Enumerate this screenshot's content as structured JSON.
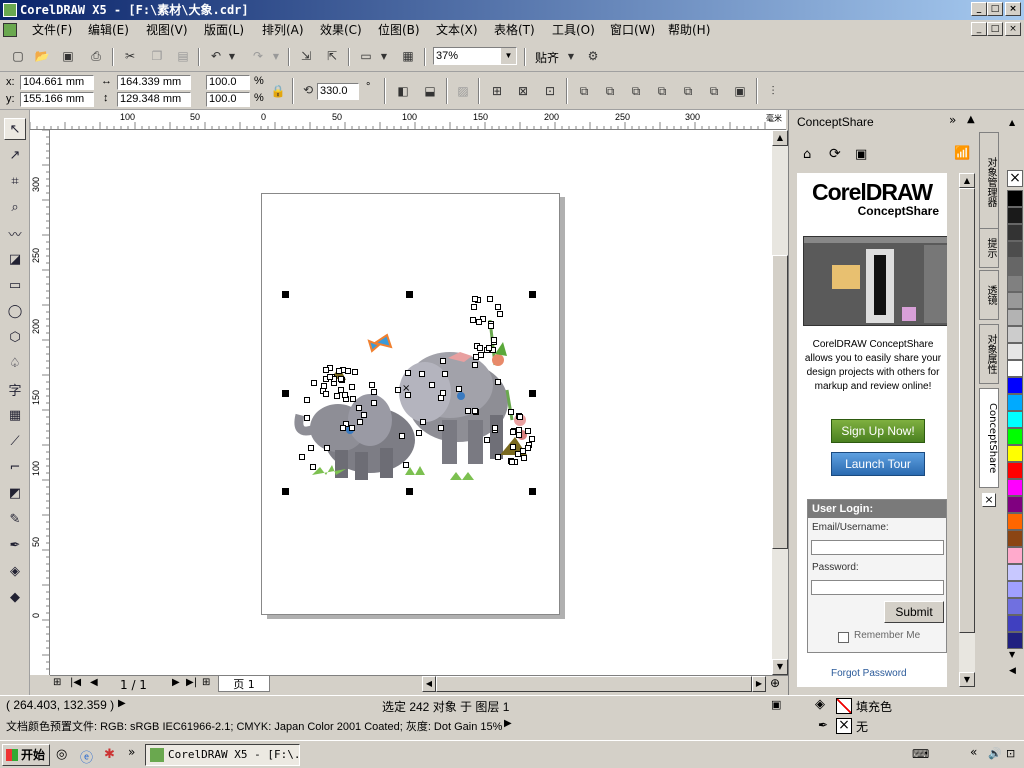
{
  "title_bar": {
    "title": "CorelDRAW X5 - [F:\\素材\\大象.cdr]",
    "min": "_",
    "max": "□",
    "close": "×"
  },
  "doc_controls": {
    "min": "_",
    "restore": "□",
    "close": "×"
  },
  "menu": [
    "文件(F)",
    "编辑(E)",
    "视图(V)",
    "版面(L)",
    "排列(A)",
    "效果(C)",
    "位图(B)",
    "文本(X)",
    "表格(T)",
    "工具(O)",
    "窗口(W)",
    "帮助(H)"
  ],
  "standard_toolbar": {
    "zoom": "37%",
    "snap": "贴齐"
  },
  "property_bar": {
    "x_label": "x:",
    "x": "104.661 mm",
    "y_label": "y:",
    "y": "155.166 mm",
    "w": "164.339 mm",
    "h": "129.348 mm",
    "scale_x": "100.0",
    "scale_y": "100.0",
    "pct": "%",
    "rotation": "330.0",
    "deg": "°"
  },
  "ruler_h_ticks": [
    "100",
    "50",
    "0",
    "50",
    "100",
    "150",
    "200",
    "250",
    "300"
  ],
  "ruler_h_unit": "毫米",
  "ruler_v_ticks": [
    "300",
    "250",
    "200",
    "150",
    "100",
    "50",
    "0"
  ],
  "page_nav": {
    "pages": "1 / 1",
    "tab": "页 1"
  },
  "docker": {
    "title": "ConceptShare",
    "logo_main": "CorelDRAW",
    "logo_sub": "ConceptShare",
    "description": "CorelDRAW ConceptShare allows you to easily share your design projects with others for markup and review online!",
    "sign_up": "Sign Up Now!",
    "tour": "Launch Tour",
    "login_title": "User Login:",
    "email_label": "Email/Username:",
    "password_label": "Password:",
    "submit": "Submit",
    "remember": "Remember Me",
    "forgot": "Forgot Password"
  },
  "docker_tabs": [
    "对象管理器",
    "提示",
    "透镜",
    "对象属性",
    "ConceptShare"
  ],
  "palette_colors": [
    "#000000",
    "#1a1a1a",
    "#333333",
    "#4d4d4d",
    "#666666",
    "#808080",
    "#999999",
    "#b3b3b3",
    "#cccccc",
    "#e6e6e6",
    "#ffffff",
    "#0000ff",
    "#00aaff",
    "#00ffff",
    "#00ff00",
    "#ffff00",
    "#ff0000",
    "#ff00ff",
    "#800080",
    "#ff6600",
    "#8b4513",
    "#ffaacc",
    "#c8c8ff",
    "#a0a0ff",
    "#7070e0",
    "#4040c0",
    "#202080"
  ],
  "status": {
    "coords": "( 264.403, 132.359 )",
    "selection": "选定 242 对象 于 图层 1",
    "profile": "文档颜色预置文件: RGB: sRGB IEC61966-2.1; CMYK: Japan Color 2001 Coated; 灰度: Dot Gain 15%",
    "fill_label": "填充色",
    "outline_label": "无"
  },
  "taskbar": {
    "start": "开始",
    "app": "CorelDRAW X5 - [F:\\..."
  }
}
